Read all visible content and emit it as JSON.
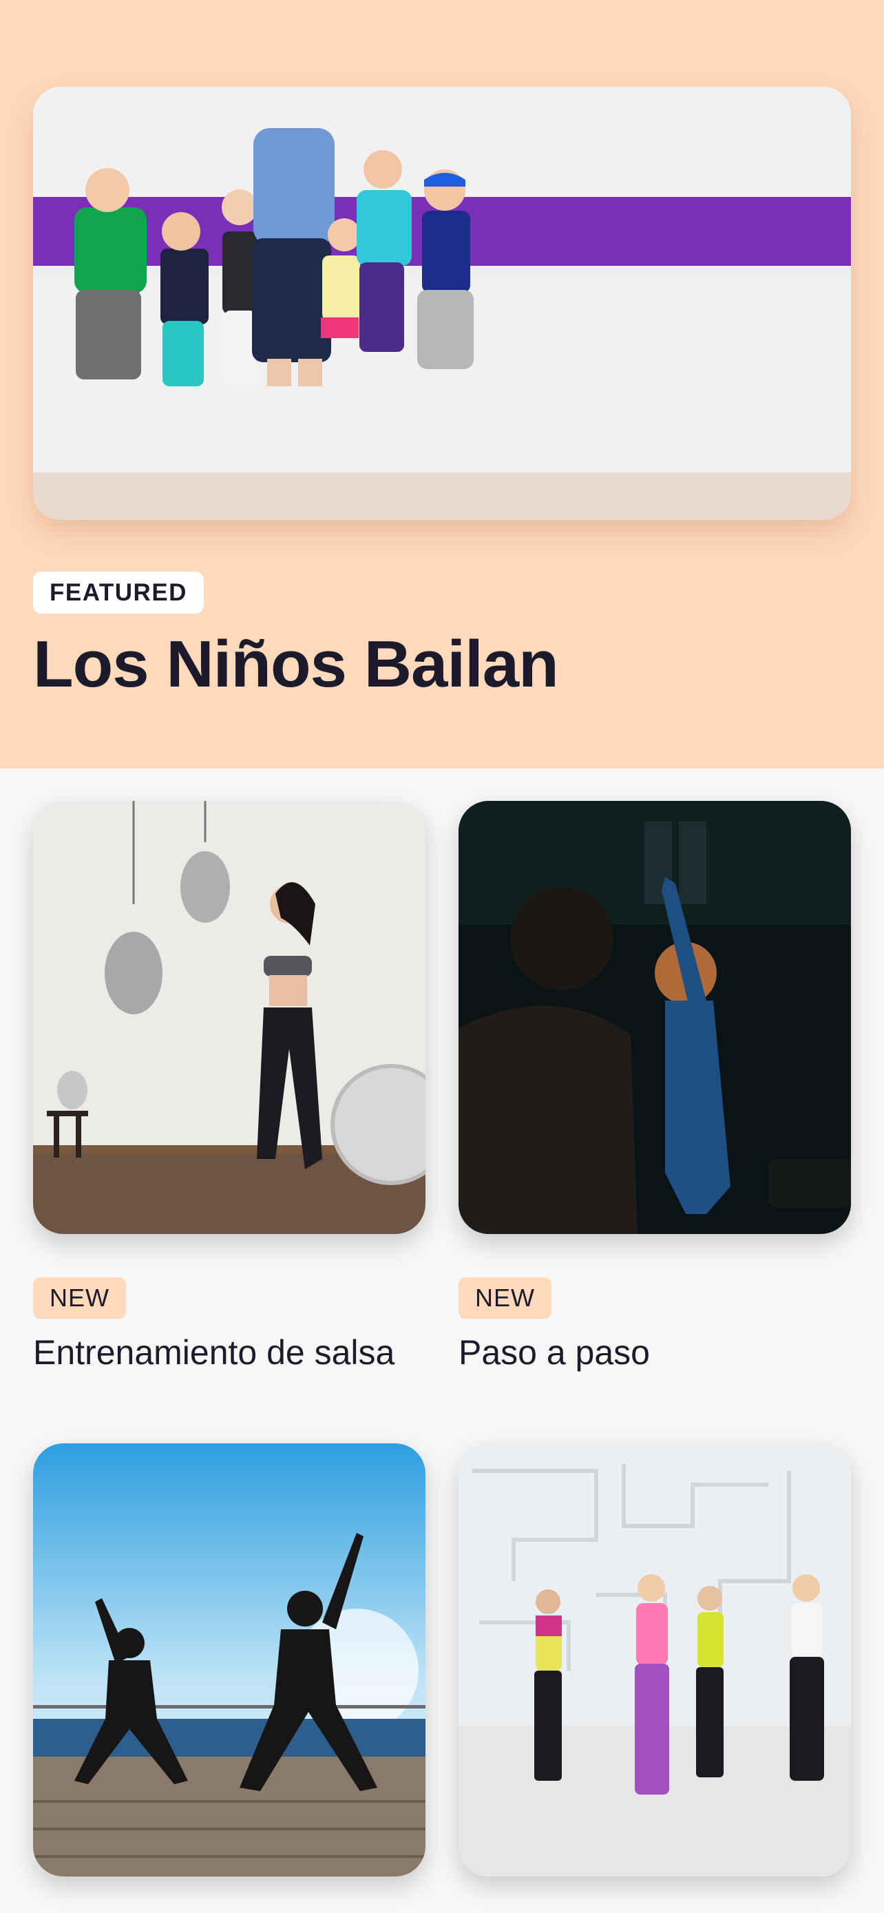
{
  "colors": {
    "hero_background": "#ffd9bc",
    "page_background": "#f7f7f8",
    "badge_new_background": "#ffd9bc",
    "badge_featured_background": "#ffffff",
    "text": "#1c1b2b"
  },
  "featured": {
    "badge": "FEATURED",
    "title": "Los Niños Bailan",
    "image_alt": "kids-dance-class-photo"
  },
  "cards": [
    {
      "badge": "NEW",
      "title": "Entrenamiento de salsa",
      "image_alt": "belly-dancer-photo"
    },
    {
      "badge": "NEW",
      "title": "Paso a paso",
      "image_alt": "dark-studio-dancers-photo"
    },
    {
      "badge": "",
      "title": "",
      "image_alt": "beach-dance-workout-photo"
    },
    {
      "badge": "",
      "title": "",
      "image_alt": "studio-zumba-class-photo"
    }
  ]
}
